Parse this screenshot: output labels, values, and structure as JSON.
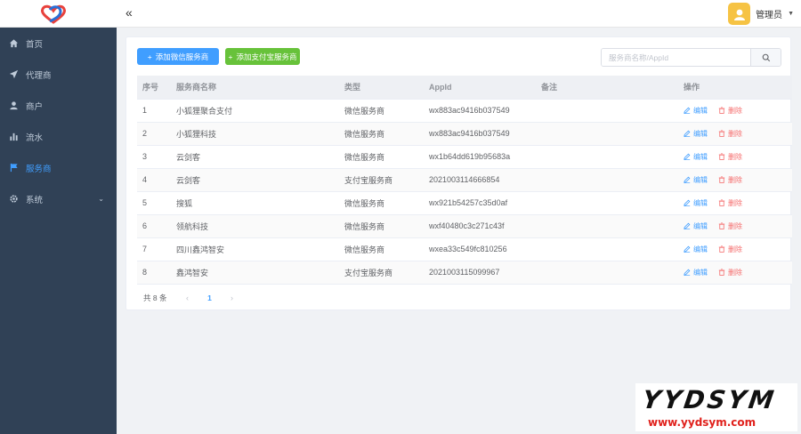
{
  "header": {
    "collapse_icon": "double-chevron-left-icon",
    "username": "管理员"
  },
  "sidebar": {
    "items": [
      {
        "label": "首页",
        "icon": "home-icon"
      },
      {
        "label": "代理商",
        "icon": "send-icon"
      },
      {
        "label": "商户",
        "icon": "user-icon"
      },
      {
        "label": "流水",
        "icon": "bar-chart-icon"
      },
      {
        "label": "服务商",
        "icon": "flag-icon",
        "active": true
      },
      {
        "label": "系统",
        "icon": "gear-icon",
        "has_children": true
      }
    ]
  },
  "toolbar": {
    "add_wechat_label": "添加微信服务商",
    "add_alipay_label": "添加支付宝服务商",
    "search_placeholder": "服务商名称/AppId"
  },
  "table": {
    "columns": [
      "序号",
      "服务商名称",
      "类型",
      "AppId",
      "备注",
      "操作"
    ],
    "edit_label": "编辑",
    "delete_label": "删除",
    "rows": [
      {
        "index": "1",
        "name": "小狐狸聚合支付",
        "type": "微信服务商",
        "appid": "wx883ac9416b037549",
        "remark": ""
      },
      {
        "index": "2",
        "name": "小狐狸科技",
        "type": "微信服务商",
        "appid": "wx883ac9416b037549",
        "remark": ""
      },
      {
        "index": "3",
        "name": "云剑客",
        "type": "微信服务商",
        "appid": "wx1b64dd619b95683a",
        "remark": ""
      },
      {
        "index": "4",
        "name": "云剑客",
        "type": "支付宝服务商",
        "appid": "2021003114666854",
        "remark": ""
      },
      {
        "index": "5",
        "name": "搜狐",
        "type": "微信服务商",
        "appid": "wx921b54257c35d0af",
        "remark": ""
      },
      {
        "index": "6",
        "name": "领航科技",
        "type": "微信服务商",
        "appid": "wxf40480c3c271c43f",
        "remark": ""
      },
      {
        "index": "7",
        "name": "四川鑫鸿智安",
        "type": "微信服务商",
        "appid": "wxea33c549fc810256",
        "remark": ""
      },
      {
        "index": "8",
        "name": "鑫鸿智安",
        "type": "支付宝服务商",
        "appid": "2021003115099967",
        "remark": ""
      }
    ]
  },
  "pagination": {
    "total_text": "共 8 条",
    "current_page": "1"
  },
  "watermark": {
    "big": "YYDSYM",
    "small": "www.yydsym.com"
  },
  "colors": {
    "sidebar_bg": "#304156",
    "primary": "#409eff",
    "success": "#67c23a",
    "danger": "#f56c6c",
    "avatar": "#f6c344"
  }
}
